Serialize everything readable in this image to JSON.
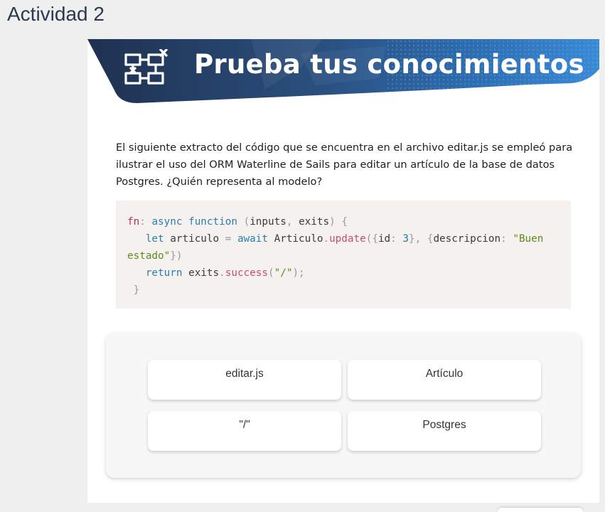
{
  "page": {
    "title": "Actividad 2"
  },
  "banner": {
    "icon": "flowchart-icon",
    "title": "Prueba tus conocimientos",
    "colors": {
      "dark": "#243a5a",
      "blue": "#2a72b4"
    }
  },
  "question": {
    "text": "El siguiente extracto del código que se encuentra en el archivo editar.js se empleó para ilustrar el uso del ORM Waterline de Sails para editar un artículo de la base de datos Postgres. ¿Quién representa al modelo?"
  },
  "code": {
    "line1": {
      "fn": "fn",
      "colon": ": ",
      "async": "async",
      "function": "function",
      "open": " (",
      "inputs": "inputs",
      "comma": ", ",
      "exits": "exits",
      "close": ") {"
    },
    "line2": {
      "indent": "   ",
      "let": "let",
      "varname": " articulo ",
      "eq": "= ",
      "await": "await",
      "model": " Articulo",
      "dot": ".",
      "method": "update",
      "p1": "({",
      "idkey": "id",
      "colon1": ": ",
      "idval": "3",
      "p2": "}, {",
      "desckey": "descripcion",
      "colon2": ": ",
      "descval_a": "\"Buen"
    },
    "line3": {
      "descval_b": "estado\"",
      "close": "})"
    },
    "line4": {
      "indent": "   ",
      "return": "return",
      "obj": " exits",
      "dot": ".",
      "method": "success",
      "p1": "(",
      "arg": "\"/\"",
      "p2": ");"
    },
    "line5": {
      "brace": " }"
    }
  },
  "options": [
    {
      "label": "editar.js"
    },
    {
      "label": "Artículo"
    },
    {
      "label": "\"/\""
    },
    {
      "label": "Postgres"
    }
  ]
}
